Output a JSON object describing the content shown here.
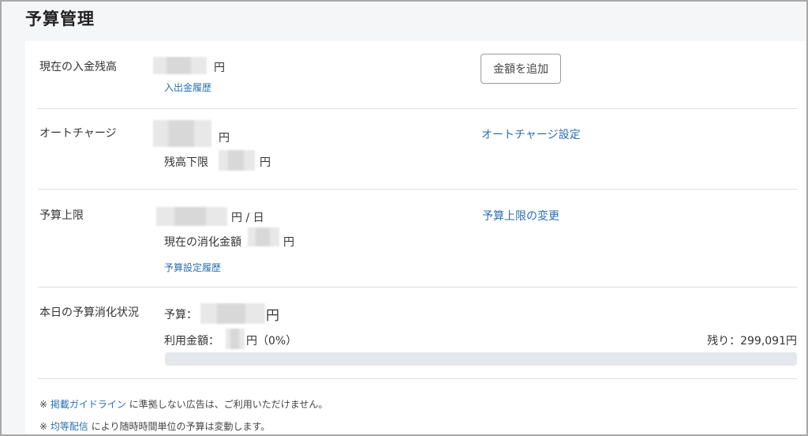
{
  "title": "予算管理",
  "balance": {
    "label": "現在の入金残高",
    "unit": "円",
    "history_link": "入出金履歴",
    "add_button": "金額を追加"
  },
  "autocharge": {
    "label": "オートチャージ",
    "unit": "円",
    "min_label": "残高下限",
    "min_unit": "円",
    "settings_link": "オートチャージ設定"
  },
  "budget_limit": {
    "label": "予算上限",
    "unit": "円 / 日",
    "current_label": "現在の消化金額",
    "current_unit": "円",
    "history_link": "予算設定履歴",
    "change_link": "予算上限の変更"
  },
  "today": {
    "label": "本日の予算消化状況",
    "budget_label": "予算：",
    "budget_unit": "円",
    "used_label": "利用金額：",
    "used_suffix": "円（0%）",
    "remaining": "残り：299,091円",
    "progress_fraction": 0.0
  },
  "notes": [
    {
      "prefix": "※ ",
      "link": "掲載ガイドライン",
      "text": " に準拠しない広告は、ご利用いただけません。"
    },
    {
      "prefix": "※ ",
      "link": "均等配信",
      "text": " により随時時間単位の予算は変動します。"
    }
  ],
  "colors": {
    "link": "#2a6fb0",
    "progress_track": "#e4e8ec",
    "divider": "#dddddd"
  }
}
